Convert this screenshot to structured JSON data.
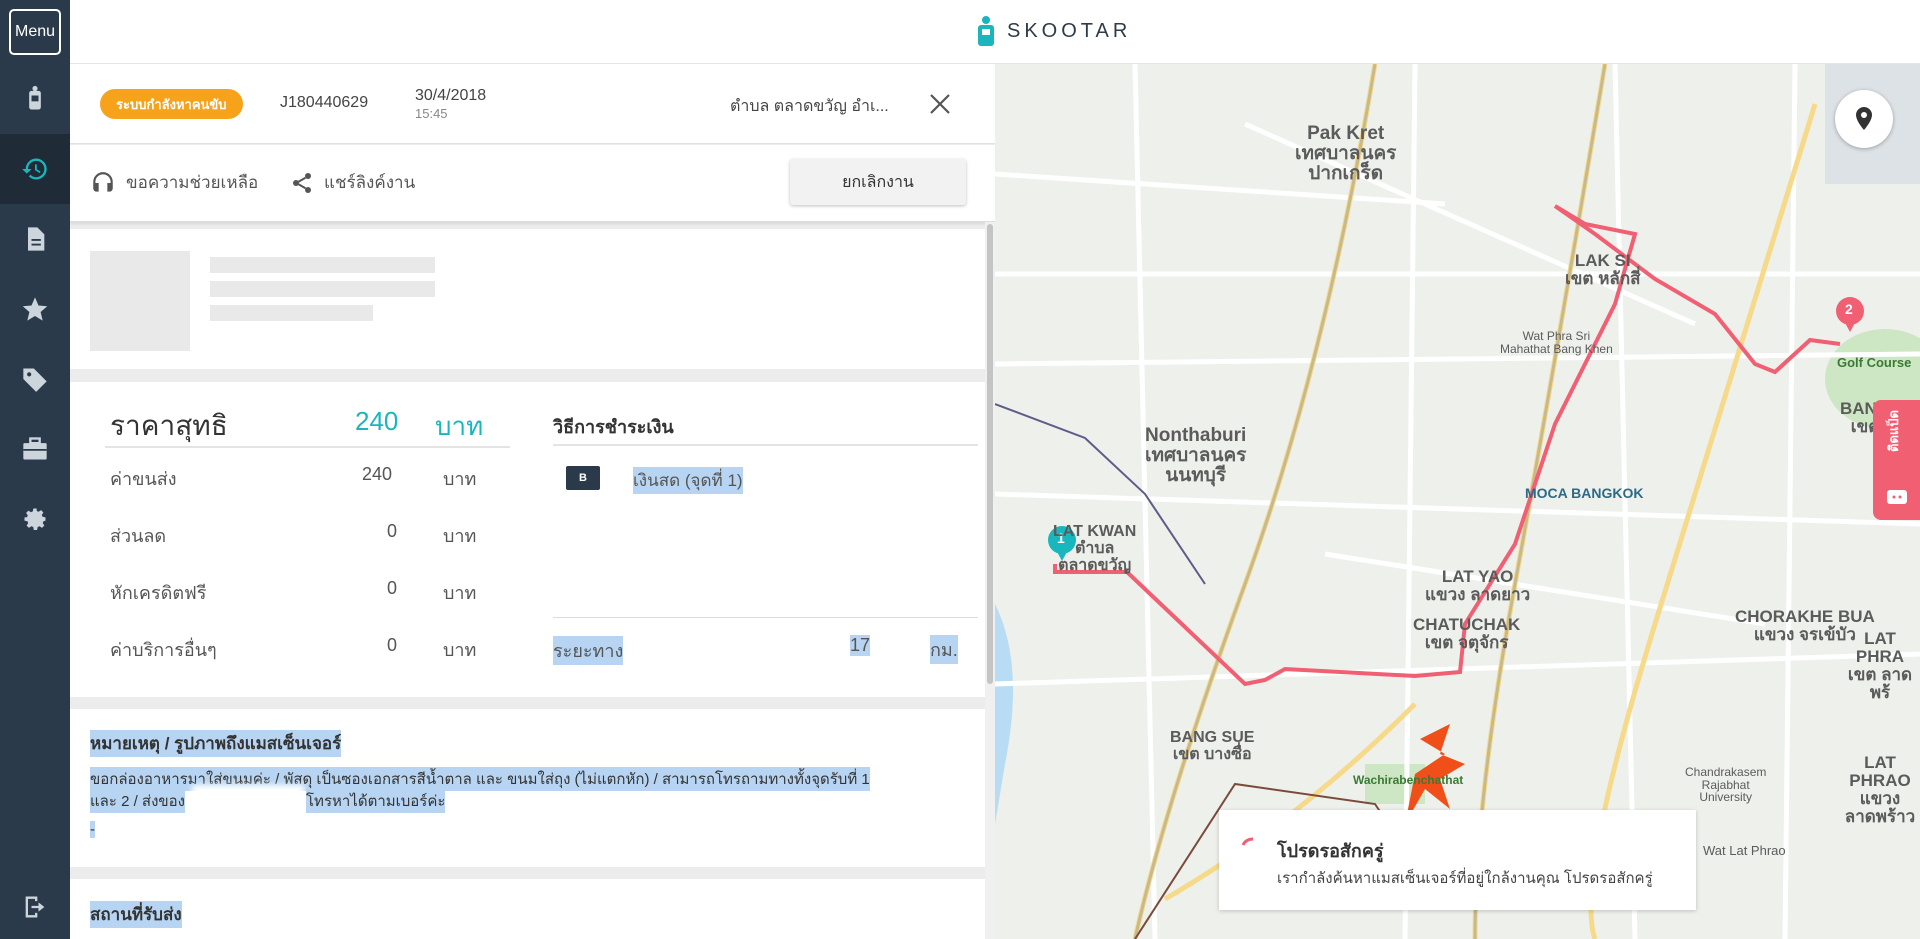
{
  "sidebar": {
    "menu_label": "Menu",
    "items": [
      {
        "icon": "courier-icon"
      },
      {
        "icon": "history-icon",
        "active": true
      },
      {
        "icon": "document-icon"
      },
      {
        "icon": "star-icon"
      },
      {
        "icon": "tag-icon"
      },
      {
        "icon": "briefcase-icon"
      },
      {
        "icon": "gear-icon"
      },
      {
        "icon": "logout-icon"
      }
    ]
  },
  "header": {
    "brand": "SKOOTAR"
  },
  "job": {
    "status": "ระบบกำลังหาคนขับ",
    "id": "J180440629",
    "date": "30/4/2018",
    "time": "15:45",
    "location": "ตำบล ตลาดขวัญ อำเ..."
  },
  "actions": {
    "help": "ขอความช่วยเหลือ",
    "share": "แชร์ลิงค์งาน",
    "cancel": "ยกเลิกงาน"
  },
  "price": {
    "total_label": "ราคาสุทธิ",
    "total_value": "240",
    "currency": "บาท",
    "rows": [
      {
        "label": "ค่าขนส่ง",
        "value": "240",
        "unit": "บาท"
      },
      {
        "label": "ส่วนลด",
        "value": "0",
        "unit": "บาท"
      },
      {
        "label": "หักเครดิตฟรี",
        "value": "0",
        "unit": "บาท"
      },
      {
        "label": "ค่าบริการอื่นๆ",
        "value": "0",
        "unit": "บาท"
      }
    ],
    "payment_title": "วิธีการชำระเงิน",
    "payment_method": "เงินสด (จุดที่ 1)",
    "payment_icon": "B",
    "distance_label": "ระยะทาง",
    "distance_value": "17",
    "distance_unit": "กม."
  },
  "note": {
    "title": "หมายเหตุ / รูปภาพถึงแมสเซ็นเจอร์",
    "line1": "ขอกล่องอาหารมาใส่ขนมค่ะ / พัสดุ เป็นซองเอกสารสีน้ำตาล และ ขนมใส่ถุง (ไม่แตกหัก) / สามารถโทรถามทางทั้งจุดรับที่ 1",
    "line2": "และ 2 / ส่งของ",
    "line2b": "โทรหาได้ตามเบอร์ค่ะ",
    "line3": "-"
  },
  "address": {
    "title": "สถานที่รับส่ง"
  },
  "map": {
    "labels": [
      {
        "text": "Pak Kret\nเทศบาลนคร\nปากเกร็ด"
      },
      {
        "text": "Nonthaburi\nเทศบาลนคร\nนนทบุรี"
      },
      {
        "text": "LAT KWAN\nตำบล\nตลาดขวัญ"
      },
      {
        "text": "LAK SI\nเขต หลักสี่"
      },
      {
        "text": "LAT YAO\nแขวง ลาดยาว"
      },
      {
        "text": "CHATUCHAK\nเขต จตุจักร"
      },
      {
        "text": "BANG SUE\nเขต บางซื่อ"
      },
      {
        "text": "CHORAKHE BUA\nแขวง จรเข้บัว"
      },
      {
        "text": "LAT PHRAO\nแขวง\nลาดพร้าว"
      },
      {
        "text": "LAT PHRA\nเขต ลาดพร้"
      },
      {
        "text": "MOCA BANGKOK"
      },
      {
        "text": "Wat Phra Sri\nMahathat Bang Khen"
      },
      {
        "text": "Chandrakasem\nRajabhat\nUniversity"
      },
      {
        "text": "Golf Course"
      },
      {
        "text": "Wachirabenchathat"
      },
      {
        "text": "Wat Lat Phrao"
      },
      {
        "text": "BANG\nเขต"
      }
    ],
    "pin1": "1",
    "pin2": "2",
    "feedback": "ติดแป็ด"
  },
  "toast": {
    "title": "โปรดรอสักครู่",
    "message": "เรากำลังค้นหาแมสเซ็นเจอร์ที่อยู่ใกล้งานคุณ โปรดรอสักครู่"
  },
  "colors": {
    "sidebar": "#2b3a4a",
    "accent": "#19b6be",
    "status": "#f7a21b",
    "route": "#f15f73"
  }
}
